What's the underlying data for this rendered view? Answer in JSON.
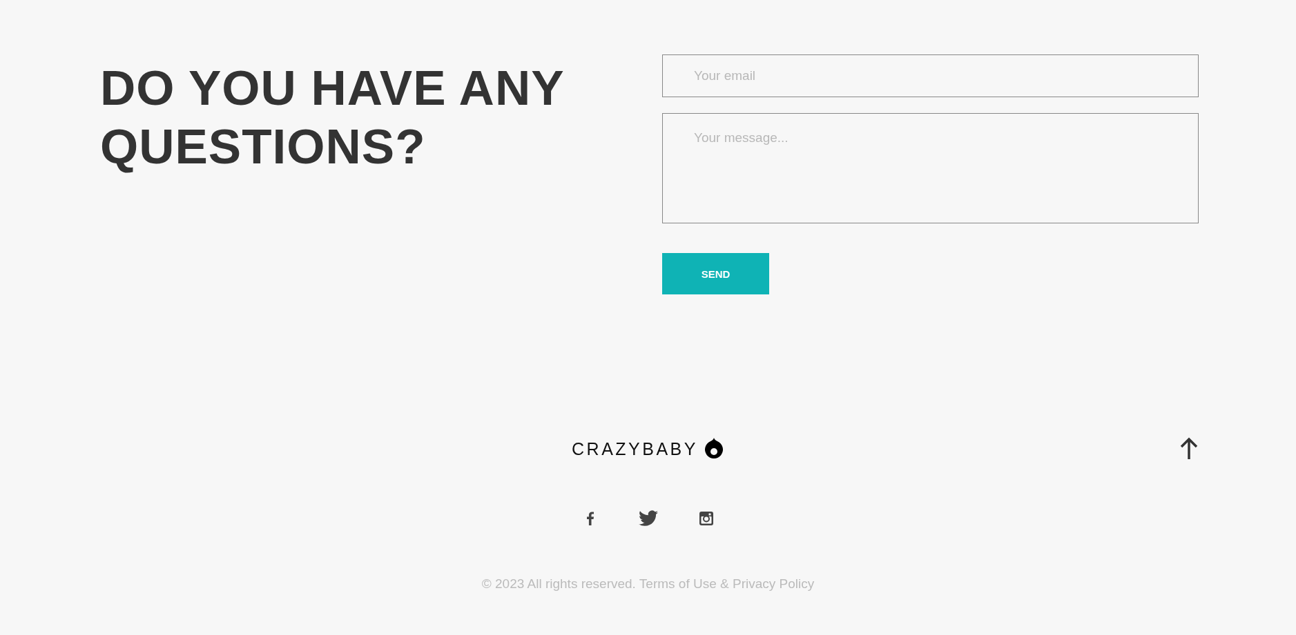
{
  "heading": "DO YOU HAVE ANY QUESTIONS?",
  "form": {
    "email": {
      "placeholder": "Your email"
    },
    "message": {
      "placeholder": "Your message..."
    },
    "submit": "SEND"
  },
  "footer": {
    "logo": "CRAZYBABY",
    "socials": [
      {
        "kind": "facebook"
      },
      {
        "kind": "twitter"
      },
      {
        "kind": "instagram"
      }
    ],
    "copyright": "© 2023 All rights reserved. Terms of Use & Privacy Policy"
  }
}
